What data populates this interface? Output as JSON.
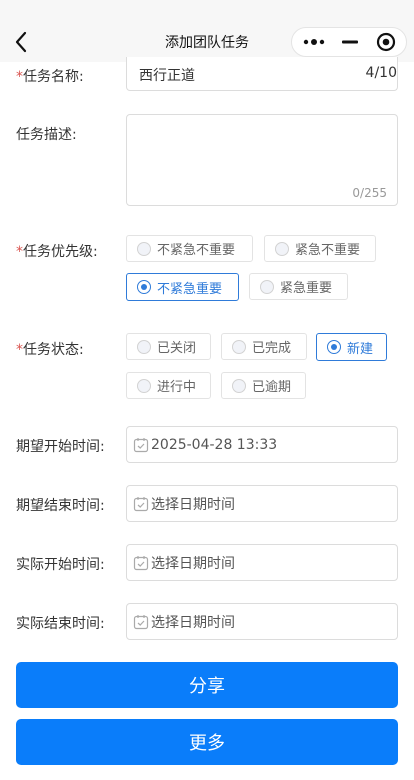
{
  "nav": {
    "title": "添加团队任务"
  },
  "form": {
    "name": {
      "label": "任务名称:",
      "value": "西行正道",
      "count": "4/10"
    },
    "desc": {
      "label": "任务描述:",
      "count": "0/255"
    },
    "priority": {
      "label": "任务优先级:",
      "options": [
        "不紧急不重要",
        "紧急不重要",
        "不紧急重要",
        "紧急重要"
      ],
      "selected": "不紧急重要"
    },
    "status": {
      "label": "任务状态:",
      "options": [
        "已关闭",
        "已完成",
        "新建",
        "进行中",
        "已逾期"
      ],
      "selected": "新建"
    },
    "expected_start": {
      "label": "期望开始时间:",
      "value": "2025-04-28 13:33"
    },
    "expected_end": {
      "label": "期望结束时间:",
      "value": "选择日期时间"
    },
    "actual_start": {
      "label": "实际开始时间:",
      "value": "选择日期时间"
    },
    "actual_end": {
      "label": "实际结束时间:",
      "value": "选择日期时间"
    },
    "required_mark": "*"
  },
  "buttons": {
    "share": "分享",
    "more": "更多"
  },
  "colors": {
    "primary": "#0a7dfa",
    "selected": "#2f7bd9",
    "required": "#d9534f"
  }
}
